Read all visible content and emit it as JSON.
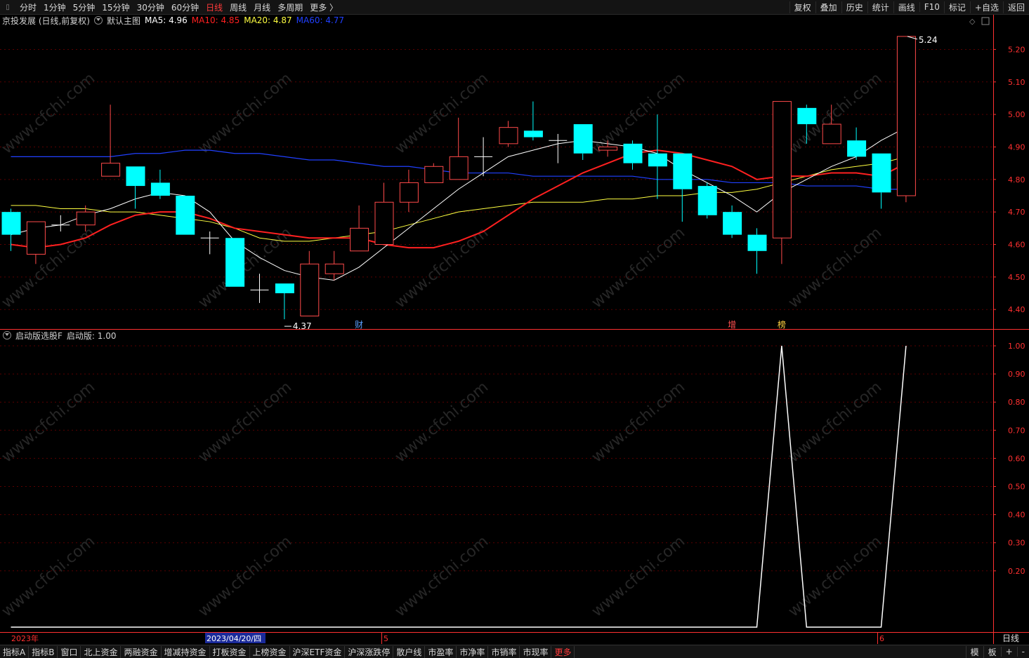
{
  "toolbar": {
    "periods": [
      "分时",
      "1分钟",
      "5分钟",
      "15分钟",
      "30分钟",
      "60分钟",
      "日线",
      "周线",
      "月线",
      "多周期",
      "更多 〉"
    ],
    "active_period": "日线",
    "right_buttons": [
      "复权",
      "叠加",
      "历史",
      "统计",
      "画线",
      "F10",
      "标记",
      "+自选",
      "返回"
    ]
  },
  "main_chart": {
    "stock_title": "京投发展 (日线,前复权)",
    "indicator_name": "默认主图",
    "ma5_label": "MA5: 4.96",
    "ma10_label": "MA10: 4.85",
    "ma20_label": "MA20: 4.87",
    "ma60_label": "MA60: 4.77",
    "high_marker": "5.24",
    "low_marker": "4.37",
    "event_markers": [
      "财",
      "增",
      "榜"
    ]
  },
  "sub_chart": {
    "indicator_name": "启动版选股F",
    "value_label": "启动版: 1.00"
  },
  "time_axis": {
    "year_label": "2023年",
    "cursor_date": "2023/04/20/四",
    "month5": "5",
    "month6": "6",
    "period_badge": "日线"
  },
  "bottom_tabs": [
    "指标A",
    "指标B",
    "窗口",
    "北上资金",
    "两融资金",
    "增减持资金",
    "打板资金",
    "上榜资金",
    "沪深ETF资金",
    "沪深涨跌停",
    "散户线",
    "市盈率",
    "市净率",
    "市销率",
    "市现率",
    "更多"
  ],
  "bottom_right": [
    "模",
    "板",
    "+",
    "-"
  ],
  "watermark": "www.cfchi.com",
  "colors": {
    "up": "#ff4a4a",
    "down": "#00ffff",
    "ma5": "#ffffff",
    "ma10": "#ff2020",
    "ma20": "#ffff40",
    "ma60": "#2040ff",
    "grid": "#5a0000",
    "axis": "#ff3030"
  },
  "chart_data": [
    {
      "type": "candlestick",
      "y_ticks": [
        "5.20",
        "5.10",
        "5.00",
        "4.90",
        "4.80",
        "4.70",
        "4.60",
        "4.50",
        "4.40"
      ],
      "ylim": [
        4.34,
        5.27
      ],
      "candles": [
        {
          "o": 4.7,
          "c": 4.63,
          "h": 4.71,
          "l": 4.58
        },
        {
          "o": 4.57,
          "c": 4.67,
          "h": 4.67,
          "l": 4.54
        },
        {
          "o": 4.66,
          "c": 4.66,
          "h": 4.69,
          "l": 4.64
        },
        {
          "o": 4.66,
          "c": 4.7,
          "h": 4.72,
          "l": 4.64
        },
        {
          "o": 4.81,
          "c": 4.85,
          "h": 5.03,
          "l": 4.81
        },
        {
          "o": 4.84,
          "c": 4.78,
          "h": 4.84,
          "l": 4.71
        },
        {
          "o": 4.79,
          "c": 4.75,
          "h": 4.83,
          "l": 4.74
        },
        {
          "o": 4.75,
          "c": 4.63,
          "h": 4.75,
          "l": 4.63
        },
        {
          "o": 4.62,
          "c": 4.62,
          "h": 4.64,
          "l": 4.57
        },
        {
          "o": 4.62,
          "c": 4.47,
          "h": 4.62,
          "l": 4.47
        },
        {
          "o": 4.46,
          "c": 4.46,
          "h": 4.51,
          "l": 4.42
        },
        {
          "o": 4.48,
          "c": 4.45,
          "h": 4.48,
          "l": 4.37
        },
        {
          "o": 4.38,
          "c": 4.54,
          "h": 4.58,
          "l": 4.38
        },
        {
          "o": 4.51,
          "c": 4.54,
          "h": 4.58,
          "l": 4.49
        },
        {
          "o": 4.58,
          "c": 4.65,
          "h": 4.72,
          "l": 4.58
        },
        {
          "o": 4.6,
          "c": 4.73,
          "h": 4.79,
          "l": 4.6
        },
        {
          "o": 4.73,
          "c": 4.79,
          "h": 4.83,
          "l": 4.7
        },
        {
          "o": 4.79,
          "c": 4.84,
          "h": 4.85,
          "l": 4.79
        },
        {
          "o": 4.8,
          "c": 4.87,
          "h": 4.99,
          "l": 4.8
        },
        {
          "o": 4.87,
          "c": 4.87,
          "h": 4.93,
          "l": 4.81
        },
        {
          "o": 4.91,
          "c": 4.96,
          "h": 4.98,
          "l": 4.9
        },
        {
          "o": 4.95,
          "c": 4.93,
          "h": 5.04,
          "l": 4.92
        },
        {
          "o": 4.92,
          "c": 4.92,
          "h": 4.94,
          "l": 4.85
        },
        {
          "o": 4.97,
          "c": 4.88,
          "h": 4.97,
          "l": 4.86
        },
        {
          "o": 4.89,
          "c": 4.9,
          "h": 4.92,
          "l": 4.87
        },
        {
          "o": 4.91,
          "c": 4.85,
          "h": 4.92,
          "l": 4.83
        },
        {
          "o": 4.88,
          "c": 4.84,
          "h": 5.0,
          "l": 4.74
        },
        {
          "o": 4.88,
          "c": 4.77,
          "h": 4.88,
          "l": 4.67
        },
        {
          "o": 4.78,
          "c": 4.69,
          "h": 4.79,
          "l": 4.68
        },
        {
          "o": 4.7,
          "c": 4.63,
          "h": 4.72,
          "l": 4.62
        },
        {
          "o": 4.63,
          "c": 4.58,
          "h": 4.65,
          "l": 4.51
        },
        {
          "o": 4.62,
          "c": 5.04,
          "h": 5.04,
          "l": 4.54
        },
        {
          "o": 5.02,
          "c": 4.97,
          "h": 5.03,
          "l": 4.91
        },
        {
          "o": 4.91,
          "c": 4.97,
          "h": 5.03,
          "l": 4.91
        },
        {
          "o": 4.92,
          "c": 4.87,
          "h": 4.96,
          "l": 4.86
        },
        {
          "o": 4.88,
          "c": 4.76,
          "h": 4.88,
          "l": 4.71
        },
        {
          "o": 4.75,
          "c": 5.24,
          "h": 5.24,
          "l": 4.73
        }
      ],
      "ma5": [
        4.63,
        4.65,
        4.66,
        4.69,
        4.71,
        4.74,
        4.76,
        4.75,
        4.7,
        4.61,
        4.56,
        4.52,
        4.5,
        4.49,
        4.53,
        4.59,
        4.65,
        4.71,
        4.77,
        4.82,
        4.87,
        4.89,
        4.91,
        4.92,
        4.91,
        4.9,
        4.88,
        4.83,
        4.79,
        4.75,
        4.7,
        4.76,
        4.8,
        4.84,
        4.87,
        4.92,
        4.96
      ],
      "ma10": [
        4.6,
        4.59,
        4.6,
        4.62,
        4.66,
        4.69,
        4.7,
        4.7,
        4.68,
        4.65,
        4.64,
        4.63,
        4.62,
        4.62,
        4.62,
        4.6,
        4.59,
        4.59,
        4.61,
        4.64,
        4.69,
        4.74,
        4.78,
        4.82,
        4.85,
        4.88,
        4.89,
        4.88,
        4.86,
        4.84,
        4.8,
        4.81,
        4.81,
        4.82,
        4.82,
        4.81,
        4.85
      ],
      "ma20": [
        4.72,
        4.72,
        4.71,
        4.71,
        4.7,
        4.7,
        4.69,
        4.68,
        4.67,
        4.65,
        4.62,
        4.61,
        4.61,
        4.62,
        4.63,
        4.64,
        4.66,
        4.68,
        4.7,
        4.71,
        4.72,
        4.73,
        4.73,
        4.73,
        4.74,
        4.74,
        4.75,
        4.75,
        4.76,
        4.76,
        4.77,
        4.79,
        4.81,
        4.83,
        4.84,
        4.85,
        4.87
      ],
      "ma60": [
        4.87,
        4.87,
        4.87,
        4.87,
        4.87,
        4.88,
        4.88,
        4.89,
        4.89,
        4.88,
        4.88,
        4.87,
        4.86,
        4.86,
        4.85,
        4.84,
        4.84,
        4.83,
        4.82,
        4.82,
        4.82,
        4.81,
        4.81,
        4.81,
        4.81,
        4.81,
        4.8,
        4.8,
        4.8,
        4.79,
        4.79,
        4.79,
        4.78,
        4.78,
        4.78,
        4.77,
        4.77
      ]
    },
    {
      "type": "line",
      "series": [
        {
          "name": "启动版",
          "values": [
            0,
            0,
            0,
            0,
            0,
            0,
            0,
            0,
            0,
            0,
            0,
            0,
            0,
            0,
            0,
            0,
            0,
            0,
            0,
            0,
            0,
            0,
            0,
            0,
            0,
            0,
            0,
            0,
            0,
            0,
            0,
            1,
            0,
            0,
            0,
            0,
            1
          ]
        }
      ],
      "y_ticks": [
        "1.00",
        "0.90",
        "0.80",
        "0.70",
        "0.60",
        "0.50",
        "0.40",
        "0.30",
        "0.20"
      ],
      "ylim": [
        0,
        1.0
      ]
    }
  ]
}
